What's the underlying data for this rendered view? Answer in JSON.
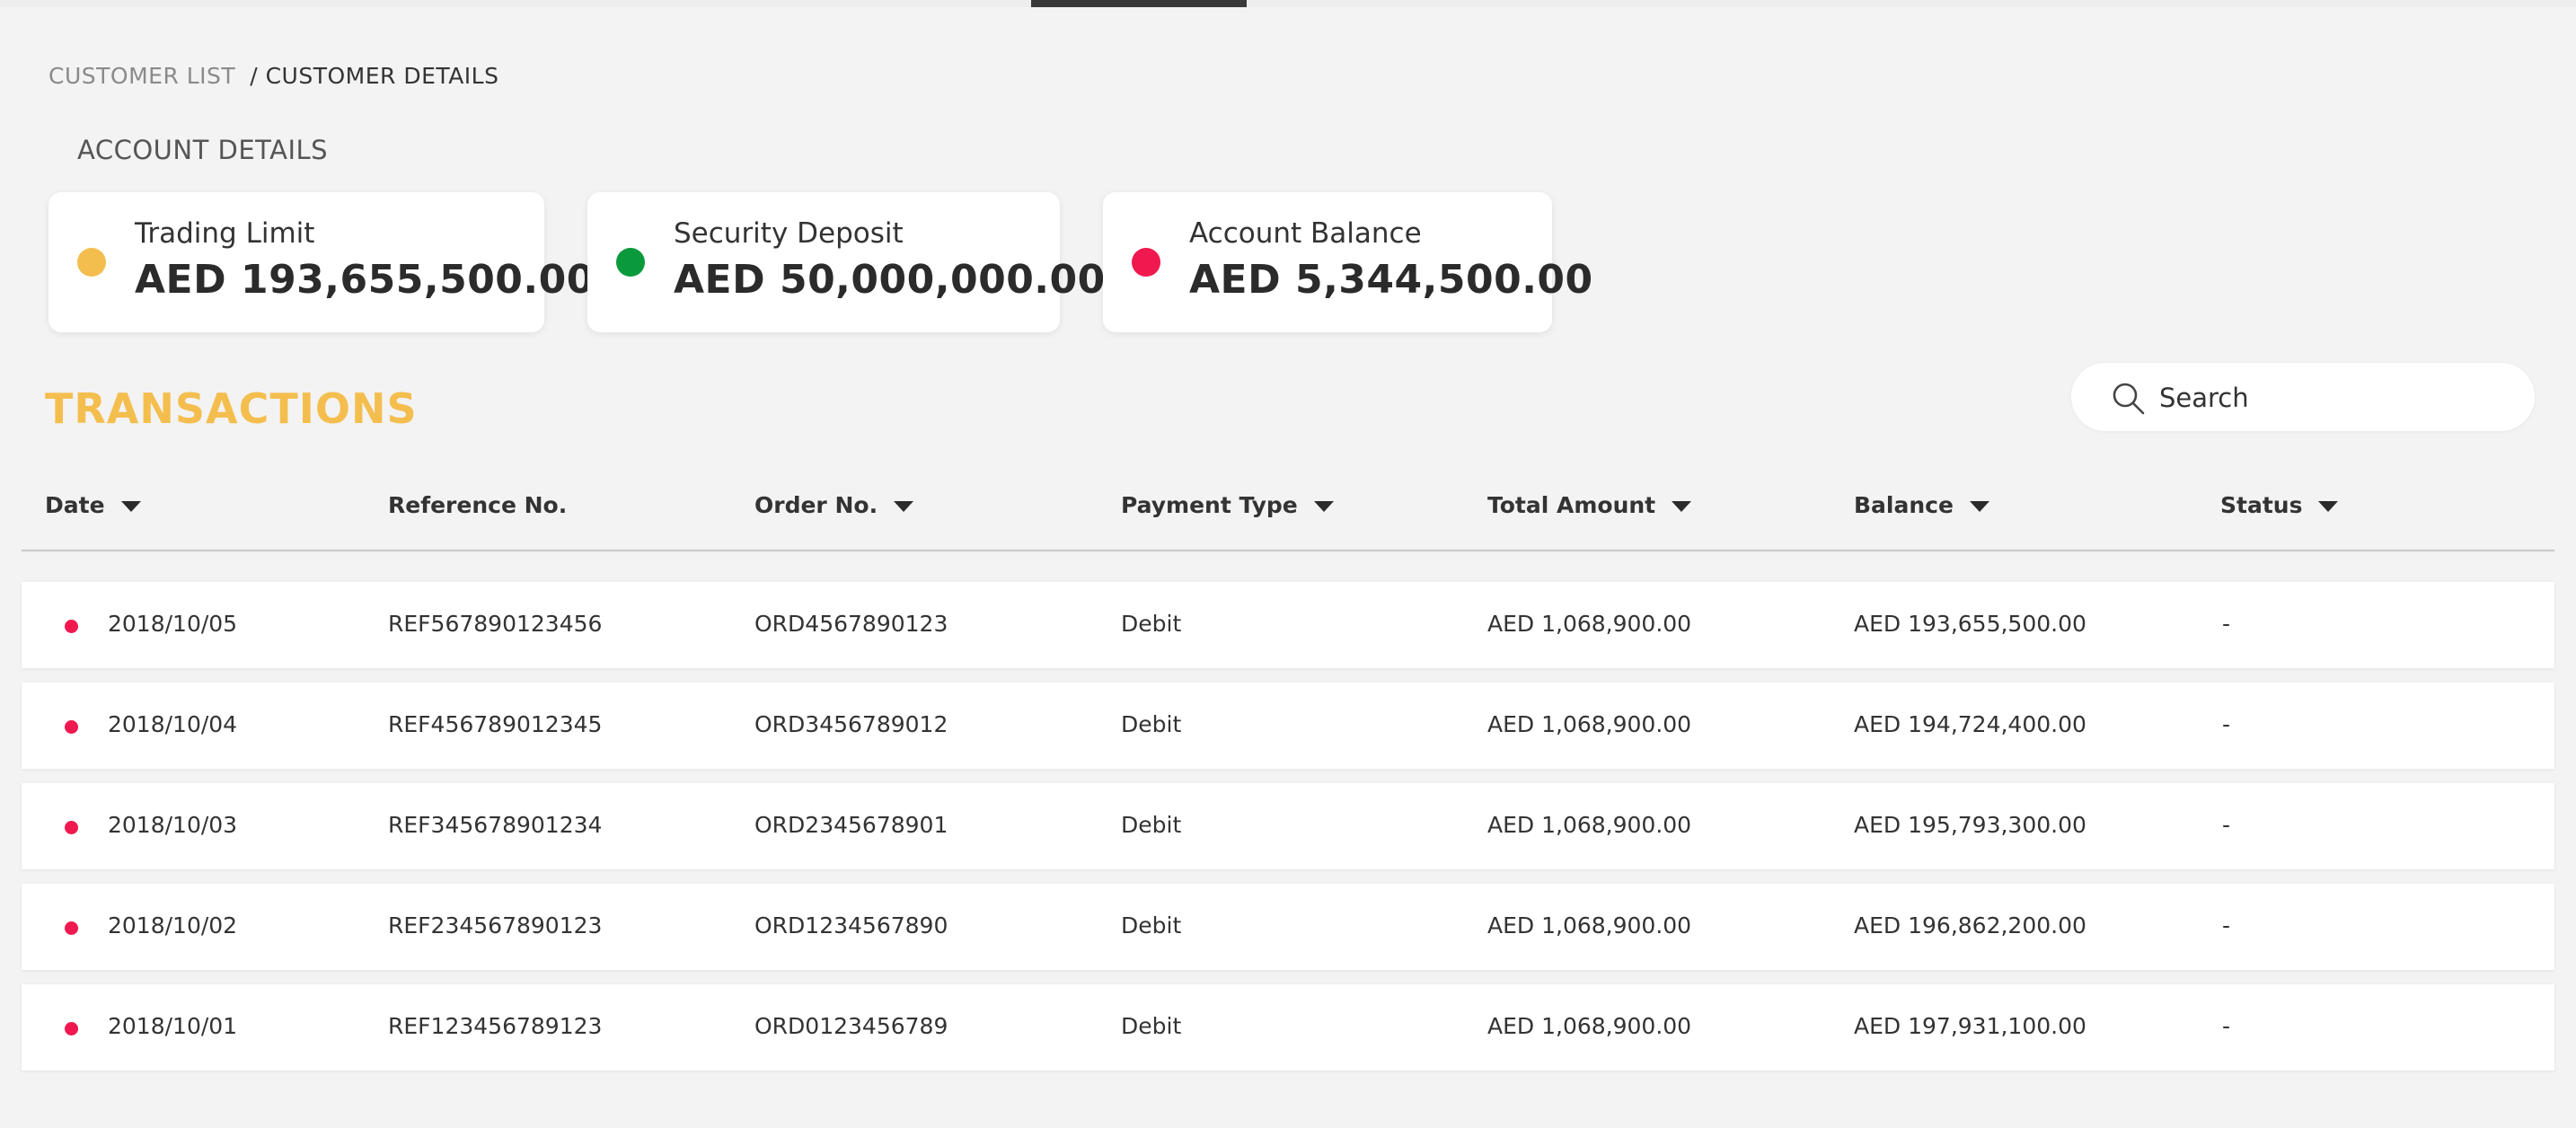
{
  "breadcrumb": {
    "parent": "CUSTOMER LIST",
    "current": "/ CUSTOMER DETAILS"
  },
  "account": {
    "label": "ACCOUNT DETAILS",
    "cards": [
      {
        "title": "Trading Limit",
        "value": "AED 193,655,500.00",
        "color": "#f4be4f"
      },
      {
        "title": "Security Deposit",
        "value": "AED 50,000,000.00",
        "color": "#0a9a3c"
      },
      {
        "title": "Account Balance",
        "value": "AED 5,344,500.00",
        "color": "#f0194f"
      }
    ]
  },
  "transactions": {
    "title": "TRANSACTIONS",
    "title_color": "#f4be4f",
    "search_placeholder": "Search",
    "columns": [
      "Date",
      "Reference No.",
      "Order No.",
      "Payment Type",
      "Total Amount",
      "Balance",
      "Status"
    ],
    "rows": [
      {
        "date": "2018/10/05",
        "ref": "REF567890123456",
        "order": "ORD4567890123",
        "type": "Debit",
        "total": "AED 1,068,900.00",
        "balance": "AED 193,655,500.00",
        "status": "-"
      },
      {
        "date": "2018/10/04",
        "ref": "REF456789012345",
        "order": "ORD3456789012",
        "type": "Debit",
        "total": "AED 1,068,900.00",
        "balance": "AED 194,724,400.00",
        "status": "-"
      },
      {
        "date": "2018/10/03",
        "ref": "REF345678901234",
        "order": "ORD2345678901",
        "type": "Debit",
        "total": "AED 1,068,900.00",
        "balance": "AED 195,793,300.00",
        "status": "-"
      },
      {
        "date": "2018/10/02",
        "ref": "REF234567890123",
        "order": "ORD1234567890",
        "type": "Debit",
        "total": "AED 1,068,900.00",
        "balance": "AED 196,862,200.00",
        "status": "-"
      },
      {
        "date": "2018/10/01",
        "ref": "REF123456789123",
        "order": "ORD0123456789",
        "type": "Debit",
        "total": "AED 1,068,900.00",
        "balance": "AED 197,931,100.00",
        "status": "-"
      }
    ],
    "row_dot_color": "#f0194f"
  }
}
